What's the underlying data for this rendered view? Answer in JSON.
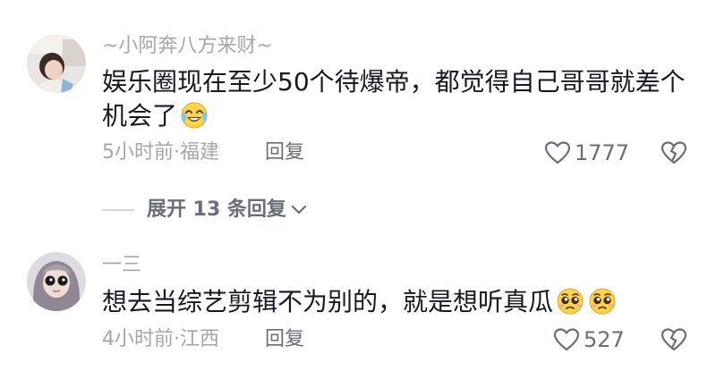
{
  "comments": [
    {
      "username": "~小阿奔八方来财~",
      "text_line1": "娱乐圈现在至少50个待爆帝，都觉得自己哥哥就差个",
      "text_line2": "机会了",
      "emoji_line2": "laugh-cry-emoji",
      "time_location": "5小时前·福建",
      "reply_label": "回复",
      "like_count": "1777"
    },
    {
      "username": "一三",
      "text_line1": "想去当综艺剪辑不为别的，就是想听真瓜",
      "emojis": [
        "pleading-emoji",
        "pleading-emoji"
      ],
      "time_location": "4小时前·江西",
      "reply_label": "回复",
      "like_count": "527"
    }
  ],
  "expand_replies": {
    "label": "展开 13 条回复"
  },
  "colors": {
    "text": "#161823",
    "secondary": "#a6a6ab",
    "action": "#6b6e78"
  }
}
